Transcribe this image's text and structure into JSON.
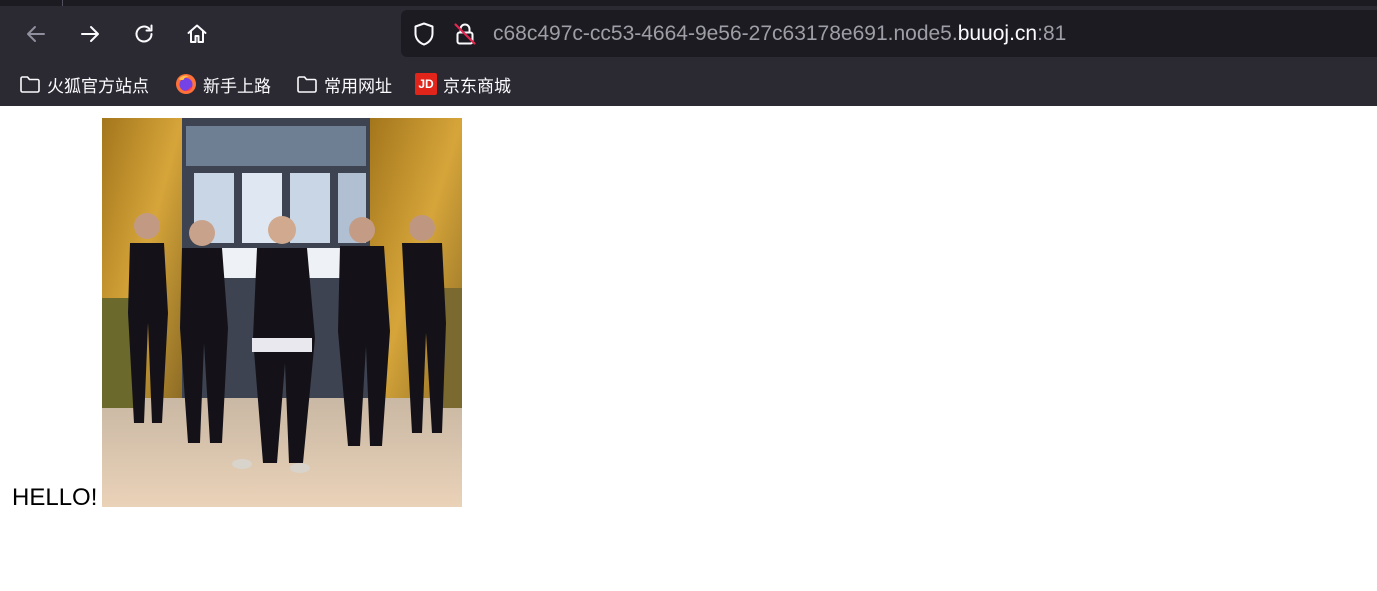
{
  "browser": {
    "nav": {
      "back": "back-arrow-icon",
      "forward": "forward-arrow-icon",
      "reload": "reload-icon",
      "home": "home-icon"
    },
    "urlbar": {
      "url_prefix": "c68c497c-cc53-4664-9e56-27c63178e691.node5.",
      "url_domain": "buuoj.cn",
      "url_suffix": ":81"
    },
    "bookmarks": [
      {
        "label": "火狐官方站点",
        "icon": "folder-icon"
      },
      {
        "label": "新手上路",
        "icon": "firefox-icon"
      },
      {
        "label": "常用网址",
        "icon": "folder-icon"
      },
      {
        "label": "京东商城",
        "icon": "jd-logo",
        "logo_text": "JD"
      }
    ]
  },
  "page": {
    "hello_text": "HELLO!",
    "image": {
      "description": "dancing-gif"
    }
  },
  "colors": {
    "chrome_bg": "#2b2a33",
    "urlbar_bg": "#1c1b22",
    "text_light": "#fbfbfe",
    "text_dim": "#9e9ea6",
    "jd_red": "#e1251b"
  }
}
